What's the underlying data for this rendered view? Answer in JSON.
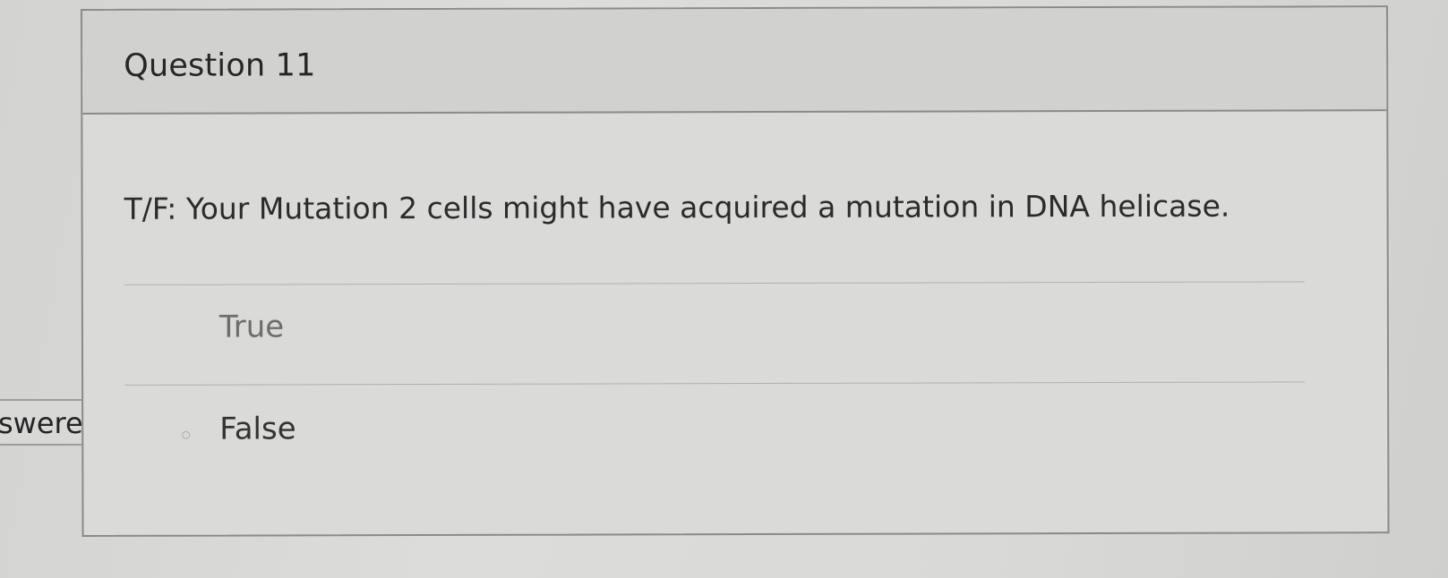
{
  "question": {
    "title": "Question 11",
    "text": "T/F: Your Mutation 2 cells might have acquired a mutation in DNA helicase.",
    "answers": [
      {
        "label": "True"
      },
      {
        "label": "False"
      }
    ]
  },
  "status_tag": {
    "label": "swered"
  },
  "colors": {
    "page_background": "#d9d9d7",
    "card_border": "#8a8a88",
    "text": "#2b2b2b",
    "muted_answer": "#6d6d6c"
  }
}
